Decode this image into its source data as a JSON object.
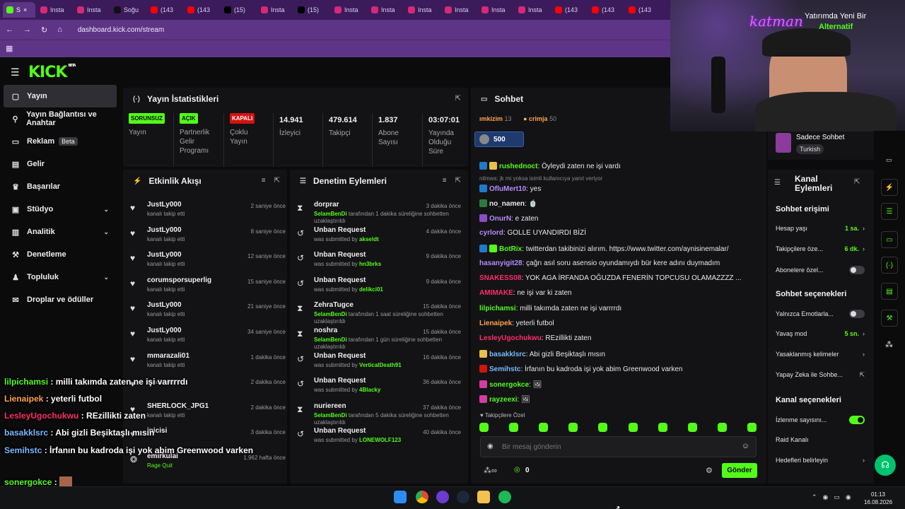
{
  "browser": {
    "tabs": [
      {
        "label": "S",
        "icon": "kick",
        "active": true
      },
      {
        "label": "Insta",
        "icon": "instagram"
      },
      {
        "label": "Insta",
        "icon": "instagram"
      },
      {
        "label": "Soğu",
        "icon": "tiktok"
      },
      {
        "label": "(143",
        "icon": "youtube"
      },
      {
        "label": "(143",
        "icon": "youtube"
      },
      {
        "label": "(15)",
        "icon": "x"
      },
      {
        "label": "Insta",
        "icon": "instagram"
      },
      {
        "label": "(15)",
        "icon": "x"
      },
      {
        "label": "Insta",
        "icon": "instagram"
      },
      {
        "label": "Insta",
        "icon": "instagram"
      },
      {
        "label": "Insta",
        "icon": "instagram"
      },
      {
        "label": "Insta",
        "icon": "instagram"
      },
      {
        "label": "Insta",
        "icon": "instagram"
      },
      {
        "label": "Insta",
        "icon": "instagram"
      },
      {
        "label": "(143",
        "icon": "youtube"
      },
      {
        "label": "(143",
        "icon": "youtube"
      },
      {
        "label": "(143",
        "icon": "youtube"
      }
    ],
    "url": "dashboard.kick.com/stream"
  },
  "logo": {
    "text": "KICK",
    "beta": "BETA"
  },
  "sidebar": {
    "items": [
      {
        "label": "Yayın",
        "icon": "▢",
        "active": true
      },
      {
        "label": "Yayın Bağlantısı ve Anahtar",
        "icon": "⚲"
      },
      {
        "label": "Reklam",
        "icon": "▭",
        "beta": "Beta"
      },
      {
        "label": "Gelir",
        "icon": "▤"
      },
      {
        "label": "Başarılar",
        "icon": "♛"
      },
      {
        "label": "Stüdyo",
        "icon": "▣",
        "chevron": true
      },
      {
        "label": "Analitik",
        "icon": "▥",
        "chevron": true
      },
      {
        "label": "Denetleme",
        "icon": "⚒"
      },
      {
        "label": "Topluluk",
        "icon": "♟",
        "chevron": true
      },
      {
        "label": "Droplar ve ödüller",
        "icon": "✉"
      }
    ]
  },
  "stats": {
    "title": "Yayın İstatistikleri",
    "cells": [
      {
        "badge": "SORUNSUZ",
        "color": "g",
        "label": "Yayın"
      },
      {
        "badge": "AÇIK",
        "color": "g",
        "label": "Partnerlik Gelir Programı"
      },
      {
        "badge": "KAPALI",
        "color": "r",
        "label": "Çoklu Yayın"
      },
      {
        "value": "14.941",
        "label": "İzleyici"
      },
      {
        "value": "479.614",
        "label": "Takipçi"
      },
      {
        "value": "1.837",
        "label": "Abone Sayısı"
      },
      {
        "value": "03:07:01",
        "label": "Yayında Olduğu Süre"
      }
    ]
  },
  "activity": {
    "title": "Etkinlik Akışı",
    "items": [
      {
        "name": "JustLy000",
        "desc": "kanalı takip etti",
        "time": "2 saniye önce"
      },
      {
        "name": "JustLy000",
        "desc": "kanalı takip etti",
        "time": "8 saniye önce"
      },
      {
        "name": "JustLy000",
        "desc": "kanalı takip etti",
        "time": "12 saniye önce"
      },
      {
        "name": "corumsporsuperlig",
        "desc": "kanalı takip etti",
        "time": "15 saniye önce"
      },
      {
        "name": "JustLy000",
        "desc": "kanalı takip etti",
        "time": "21 saniye önce"
      },
      {
        "name": "JustLy000",
        "desc": "kanalı takip etti",
        "time": "34 saniye önce"
      },
      {
        "name": "mmarazali01",
        "desc": "kanalı takip etti",
        "time": "1 dakika önce"
      },
      {
        "name": "",
        "desc": "kanalı takip etti",
        "time": "2 dakika önce"
      },
      {
        "name": "SHERLOCK_JPG1",
        "desc": "kanalı takip etti",
        "time": "2 dakika önce"
      },
      {
        "name": "inicisi",
        "desc": "",
        "time": "3 dakika önce"
      },
      {
        "name": "emirkulai",
        "desc": "Rage Quit",
        "time": "1.962 hafta önce"
      }
    ]
  },
  "moderation": {
    "title": "Denetim Eylemleri",
    "items": [
      {
        "title": "dorprar",
        "icon": "hourglass",
        "by": "SelamBenDi",
        "desc": "tarafından 1 dakika süreliğine sohbetten uzaklaştırıldı",
        "time": "3 dakika önce"
      },
      {
        "title": "Unban Request",
        "icon": "history",
        "pre": "was submitted by",
        "by": "akseldt",
        "time": "4 dakika önce"
      },
      {
        "title": "Unban Request",
        "icon": "history",
        "pre": "was submitted by",
        "by": "hn3brks",
        "time": "9 dakika önce"
      },
      {
        "title": "Unban Request",
        "icon": "history",
        "pre": "was submitted by",
        "by": "delikci01",
        "time": "9 dakika önce"
      },
      {
        "title": "ZehraTugce",
        "icon": "hourglass",
        "by": "SelamBenDi",
        "desc": "tarafından 1 saat süreliğine sohbetten uzaklaştırıldı",
        "time": "15 dakika önce"
      },
      {
        "title": "noshra",
        "icon": "hourglass",
        "by": "SelamBenDi",
        "desc": "tarafından 1 gün süreliğine sohbetten uzaklaştırıldı",
        "time": "15 dakika önce"
      },
      {
        "title": "Unban Request",
        "icon": "history",
        "pre": "was submitted by",
        "by": "VerticalDeath91",
        "time": "16 dakika önce"
      },
      {
        "title": "Unban Request",
        "icon": "history",
        "pre": "was submitted by",
        "by": "4Blacky",
        "time": "36 dakika önce"
      },
      {
        "title": "nuriereen",
        "icon": "hourglass",
        "by": "SelamBenDi",
        "desc": "tarafından 5 dakika süreliğine sohbetten uzaklaştırıldı",
        "time": "37 dakika önce"
      },
      {
        "title": "Unban Request",
        "icon": "history",
        "pre": "was submitted by",
        "by": "LONEWOLF123",
        "time": "40 dakika önce"
      }
    ]
  },
  "chat": {
    "title": "Sohbet",
    "top": [
      {
        "name": "ımkizim",
        "count": "13"
      },
      {
        "name": "crimja",
        "count": "50"
      }
    ],
    "pinned_count": "500",
    "reply_note": "nilmws: jk mi yoksa isimli kullanıcıya yanıt veriyor",
    "messages": [
      {
        "user": "rushednoct",
        "color": "#53fc18",
        "text": "Öyleydi zaten ne işi vardı",
        "badges": [
          "#1f7ac9",
          "#e9c04a"
        ]
      },
      {
        "user": "OfluMert10",
        "color": "#b58cff",
        "text": "yes",
        "badges": [
          "#1f7ac9"
        ]
      },
      {
        "user": "no_namen",
        "color": "#e8e8e8",
        "text": "🍵",
        "badges": [
          "#2d7a3e"
        ]
      },
      {
        "user": "OnurN",
        "color": "#b58cff",
        "text": "e zaten",
        "badges": [
          "#8a4cc9"
        ]
      },
      {
        "user": "cyrlord",
        "color": "#b58cff",
        "text": "GOLLE UYANDIRDI BİZİ",
        "badges": []
      },
      {
        "user": "BotRix",
        "color": "#53fc18",
        "text": "twitterdan takibinizi alırım. https://www.twitter.com/aynisinemalar/",
        "badges": [
          "#1f7ac9",
          "#53fc18"
        ]
      },
      {
        "user": "hasanyigit28",
        "color": "#b58cff",
        "text": "çağrı asıl soru asensio oyundamıydı bür kere adını duymadım",
        "badges": []
      },
      {
        "user": "SNAKESS08",
        "color": "#ff2d6a",
        "text": "YOK AGA İRFANDA OĞUZDA FENERİN TOPCUSU OLAMAZZZZ ...",
        "badges": []
      },
      {
        "user": "AMIMAKE",
        "color": "#ff2d6a",
        "text": "ne işi var ki zaten",
        "badges": []
      },
      {
        "user": "lilpichamsi",
        "color": "#53fc18",
        "text": "milli takımda zaten ne işi varrrrdı",
        "badges": []
      },
      {
        "user": "Lienaipek",
        "color": "#ffa34d",
        "text": "yeterli futbol",
        "badges": []
      },
      {
        "user": "LesleyUgochukwu",
        "color": "#ff2d6a",
        "text": "REzillikti zaten",
        "badges": []
      },
      {
        "user": "basakklsrc",
        "color": "#7ab8ff",
        "text": "Abi gizli Beşiktaşlı mısın",
        "badges": [
          "#e9c04a"
        ]
      },
      {
        "user": "Semihstc",
        "color": "#7ab8ff",
        "text": "İrfanın bu kadroda işi yok abim Greenwood varken",
        "badges": [
          "#d3130f"
        ]
      },
      {
        "user": "sonergokce",
        "color": "#53fc18",
        "text": "🖼",
        "badges": [
          "#d33ca0"
        ]
      },
      {
        "user": "rayzeexi",
        "color": "#53fc18",
        "text": "🖼",
        "badges": [
          "#d33ca0"
        ]
      }
    ],
    "followers_only": "Takipçilere Özel",
    "placeholder": "Bir mesaj gönderin",
    "points": "0",
    "send": "Gönder"
  },
  "overlay": {
    "promo_line1": "Yatırımda Yeni Bir",
    "promo_line2": "Alternatif",
    "watermark": "katman",
    "messages": [
      {
        "user": "lilpichamsi",
        "color": "#53fc18",
        "text": "milli takımda zaten ne işi varrrrdı"
      },
      {
        "user": "Lienaipek",
        "color": "#ffa34d",
        "text": "yeterli futbol"
      },
      {
        "user": "LesleyUgochukwu",
        "color": "#ff2d6a",
        "text": "REzillikti zaten"
      },
      {
        "user": "basakklsrc",
        "color": "#7ab8ff",
        "text": "Abi gizli Beşiktaşlı mısın"
      },
      {
        "user": "Semihstc",
        "color": "#7ab8ff",
        "text": "İrfanın bu kadroda işi yok abim Greenwood varken"
      },
      {
        "user": "sonergokce",
        "color": "#53fc18",
        "text": ""
      },
      {
        "user": "rayzeexi",
        "color": "#53fc18",
        "text": ""
      }
    ]
  },
  "chatmode": {
    "label": "Sadece Sohbet",
    "tag": "Turkish"
  },
  "channel": {
    "title": "Kanal Eylemleri",
    "access_title": "Sohbet erişimi",
    "access": [
      {
        "label": "Hesap yaşı",
        "value": "1 sa."
      },
      {
        "label": "Takipçilere öze...",
        "value": "6 dk."
      },
      {
        "label": "Abonelere özel...",
        "toggle": false
      }
    ],
    "chat_title": "Sohbet seçenekleri",
    "chat_opts": [
      {
        "label": "Yalnızca Emotlarla...",
        "toggle": false
      },
      {
        "label": "Yavaş mod",
        "value": "5 sn."
      },
      {
        "label": "Yasaklanmış kelimeler",
        "arrow": true
      },
      {
        "label": "Yapay Zeka ile Sohbe...",
        "ext": true
      }
    ],
    "channel_title": "Kanal seçenekleri",
    "channel_opts": [
      {
        "label": "İzlenme sayısını...",
        "toggle": true
      },
      {
        "label": "Raid Kanalı"
      },
      {
        "label": "Hedefleri belirleyin",
        "arrow": true
      }
    ]
  },
  "clock": {
    "time": "01:13",
    "date": "16.08.2026"
  },
  "colors": {
    "accent": "#53fc18",
    "browser": "#5e3486",
    "panel": "#131315"
  }
}
